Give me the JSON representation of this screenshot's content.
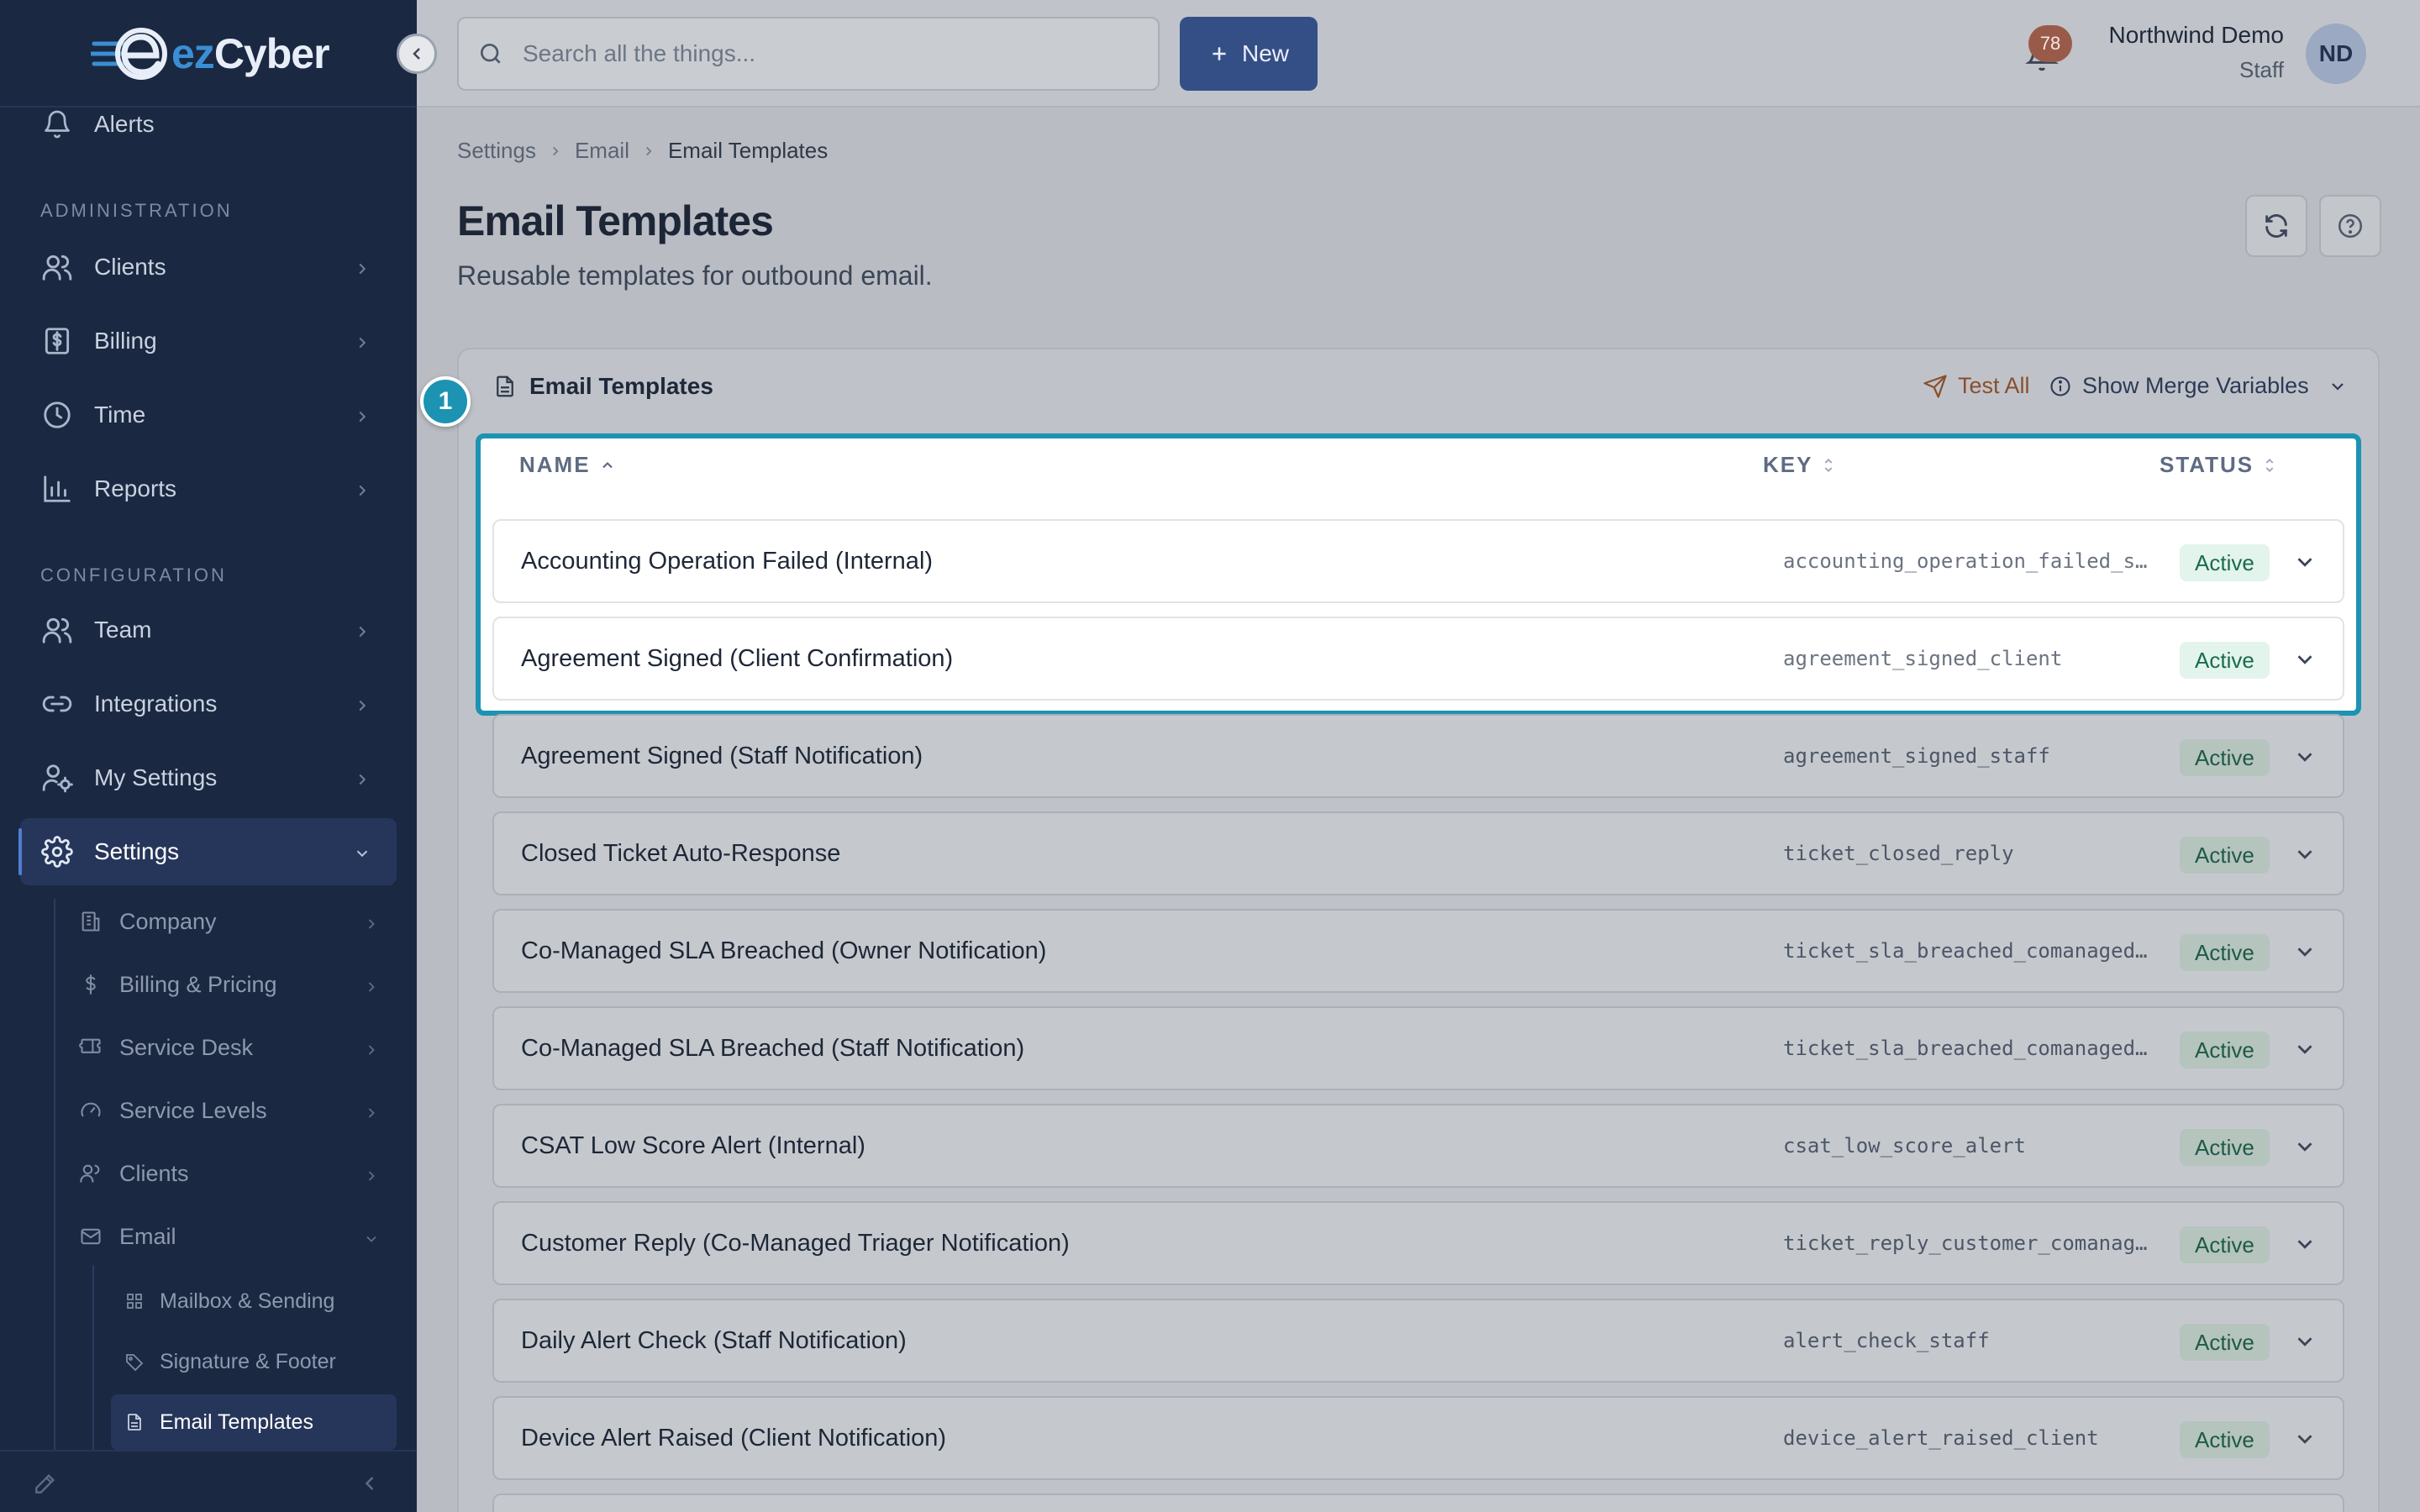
{
  "brand": {
    "name_prefix": "ez",
    "name_suffix": "Cyber"
  },
  "sidebar": {
    "top_item": {
      "label": "Alerts",
      "icon": "bell-icon"
    },
    "sections": [
      {
        "label": "ADMINISTRATION"
      },
      {
        "label": "CONFIGURATION"
      }
    ],
    "items": [
      {
        "label": "Clients",
        "icon": "users-icon"
      },
      {
        "label": "Billing",
        "icon": "dollar-icon"
      },
      {
        "label": "Time",
        "icon": "clock-icon"
      },
      {
        "label": "Reports",
        "icon": "bar-chart-icon"
      },
      {
        "label": "Team",
        "icon": "users-icon"
      },
      {
        "label": "Integrations",
        "icon": "link-icon"
      },
      {
        "label": "My Settings",
        "icon": "user-gear-icon"
      },
      {
        "label": "Settings",
        "icon": "gear-icon",
        "active": true
      }
    ],
    "settings_children": [
      {
        "label": "Company",
        "icon": "building-icon"
      },
      {
        "label": "Billing & Pricing",
        "icon": "dollar-icon"
      },
      {
        "label": "Service Desk",
        "icon": "ticket-icon"
      },
      {
        "label": "Service Levels",
        "icon": "gauge-icon"
      },
      {
        "label": "Clients",
        "icon": "users-icon"
      },
      {
        "label": "Email",
        "icon": "mail-icon",
        "expanded": true
      }
    ],
    "email_children": [
      {
        "label": "Mailbox & Sending",
        "icon": "grid-icon"
      },
      {
        "label": "Signature & Footer",
        "icon": "tag-icon"
      },
      {
        "label": "Email Templates",
        "icon": "file-icon",
        "active": true
      }
    ]
  },
  "topbar": {
    "search_placeholder": "Search all the things...",
    "new_label": "New",
    "notification_count": "78",
    "user_name": "Northwind Demo",
    "user_role": "Staff",
    "user_initials": "ND"
  },
  "breadcrumb": [
    "Settings",
    "Email",
    "Email Templates"
  ],
  "page": {
    "title": "Email Templates",
    "subtitle": "Reusable templates for outbound email."
  },
  "card": {
    "title": "Email Templates",
    "test_all_label": "Test All",
    "merge_vars_label": "Show Merge Variables",
    "step_number": "1",
    "columns": {
      "name": "NAME",
      "key": "KEY",
      "status": "STATUS"
    }
  },
  "templates": [
    {
      "name": "Accounting Operation Failed (Internal)",
      "key": "accounting_operation_failed_staff",
      "status": "Active"
    },
    {
      "name": "Agreement Signed (Client Confirmation)",
      "key": "agreement_signed_client",
      "status": "Active"
    },
    {
      "name": "Agreement Signed (Staff Notification)",
      "key": "agreement_signed_staff",
      "status": "Active"
    },
    {
      "name": "Closed Ticket Auto-Response",
      "key": "ticket_closed_reply",
      "status": "Active"
    },
    {
      "name": "Co-Managed SLA Breached (Owner Notification)",
      "key": "ticket_sla_breached_comanaged_cl…",
      "status": "Active"
    },
    {
      "name": "Co-Managed SLA Breached (Staff Notification)",
      "key": "ticket_sla_breached_comanaged_st…",
      "status": "Active"
    },
    {
      "name": "CSAT Low Score Alert (Internal)",
      "key": "csat_low_score_alert",
      "status": "Active"
    },
    {
      "name": "Customer Reply (Co-Managed Triager Notification)",
      "key": "ticket_reply_customer_comanaged_…",
      "status": "Active"
    },
    {
      "name": "Daily Alert Check (Staff Notification)",
      "key": "alert_check_staff",
      "status": "Active"
    },
    {
      "name": "Device Alert Raised (Client Notification)",
      "key": "device_alert_raised_client",
      "status": "Active"
    }
  ]
}
